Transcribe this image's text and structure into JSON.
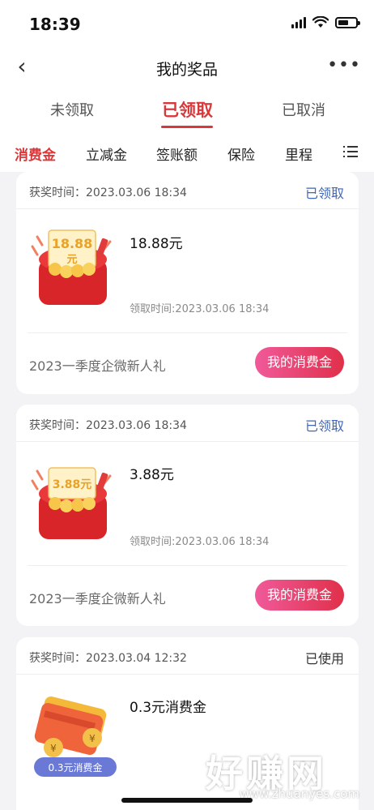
{
  "status_bar": {
    "time": "18:39"
  },
  "nav": {
    "title": "我的奖品",
    "more_glyph": "•••",
    "back_glyph": "‹"
  },
  "status_tabs": [
    "未领取",
    "已领取",
    "已取消"
  ],
  "category_tabs": [
    "消费金",
    "立减金",
    "签账额",
    "保险",
    "里程"
  ],
  "cards": [
    {
      "award_time": "获奖时间：2023.03.06 18:34",
      "status": "已领取",
      "badge_text_1": "18.88",
      "badge_text_2": "元",
      "amount": "18.88元",
      "claim_time": "领取时间:2023.03.06 18:34",
      "activity": "2023一季度企微新人礼",
      "button": "我的消费金"
    },
    {
      "award_time": "获奖时间：2023.03.06 18:34",
      "status": "已领取",
      "badge_text_1": "3.88元",
      "amount": "3.88元",
      "claim_time": "领取时间:2023.03.06 18:34",
      "activity": "2023一季度企微新人礼",
      "button": "我的消费金"
    },
    {
      "award_time": "获奖时间：2023.03.04 12:32",
      "status": "已使用",
      "amount": "0.3元消费金",
      "image_label": "0.3元消费金"
    }
  ],
  "watermark": {
    "main": "好赚网",
    "url": "www.zhuanyes.com"
  },
  "colors": {
    "accent_red": "#d9383a",
    "status_blue": "#3f66b8",
    "button_pink": "#f05a9a",
    "button_red": "#e0304a"
  }
}
